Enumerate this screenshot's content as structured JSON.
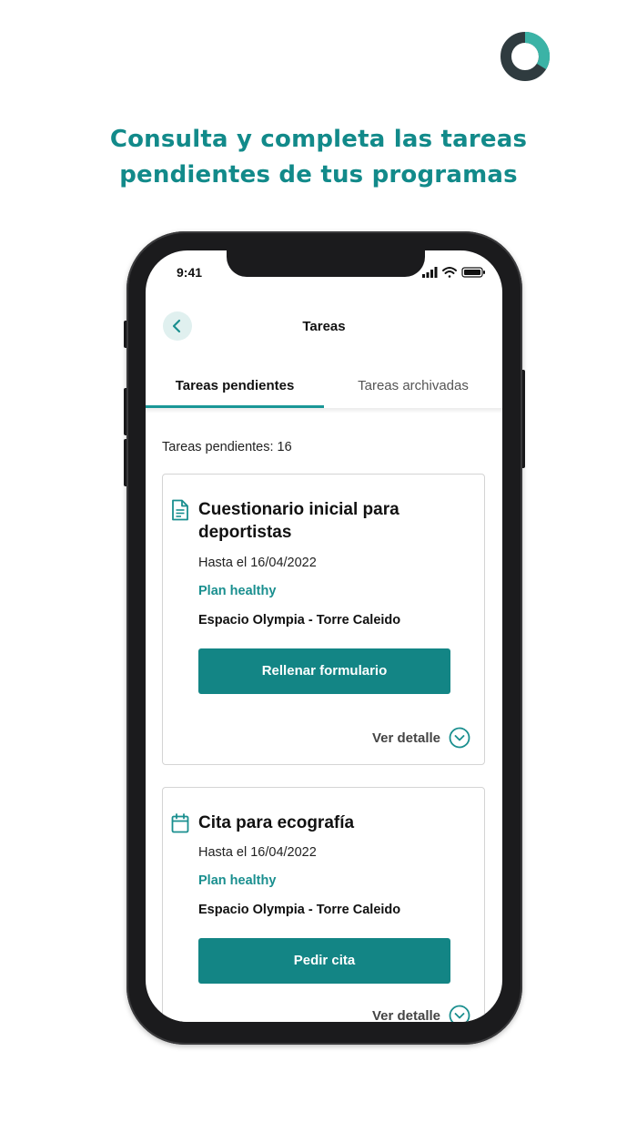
{
  "brand": {
    "accent": "#128a8a",
    "button": "#138585",
    "logo_icon": "ring-logo-icon"
  },
  "headline": {
    "line1": "Consulta y completa las tareas",
    "line2": "pendientes de tus programas"
  },
  "status_bar": {
    "time": "9:41",
    "icons": [
      "signal-icon",
      "wifi-icon",
      "battery-icon"
    ]
  },
  "nav": {
    "back_icon": "chevron-left-icon",
    "title": "Tareas"
  },
  "tabs": [
    {
      "label": "Tareas pendientes",
      "active": true
    },
    {
      "label": "Tareas archivadas",
      "active": false
    }
  ],
  "pending_count_label": "Tareas pendientes: 16",
  "tasks": [
    {
      "icon": "document-icon",
      "title": "Cuestionario inicial para deportistas",
      "date": "Hasta el 16/04/2022",
      "plan": "Plan healthy",
      "center": "Espacio Olympia - Torre Caleido",
      "action": "Rellenar formulario",
      "detail": "Ver detalle"
    },
    {
      "icon": "calendar-icon",
      "title": "Cita para ecografía",
      "date": "Hasta el 16/04/2022",
      "plan": "Plan healthy",
      "center": "Espacio Olympia - Torre Caleido",
      "action": "Pedir cita",
      "detail": "Ver detalle"
    }
  ]
}
